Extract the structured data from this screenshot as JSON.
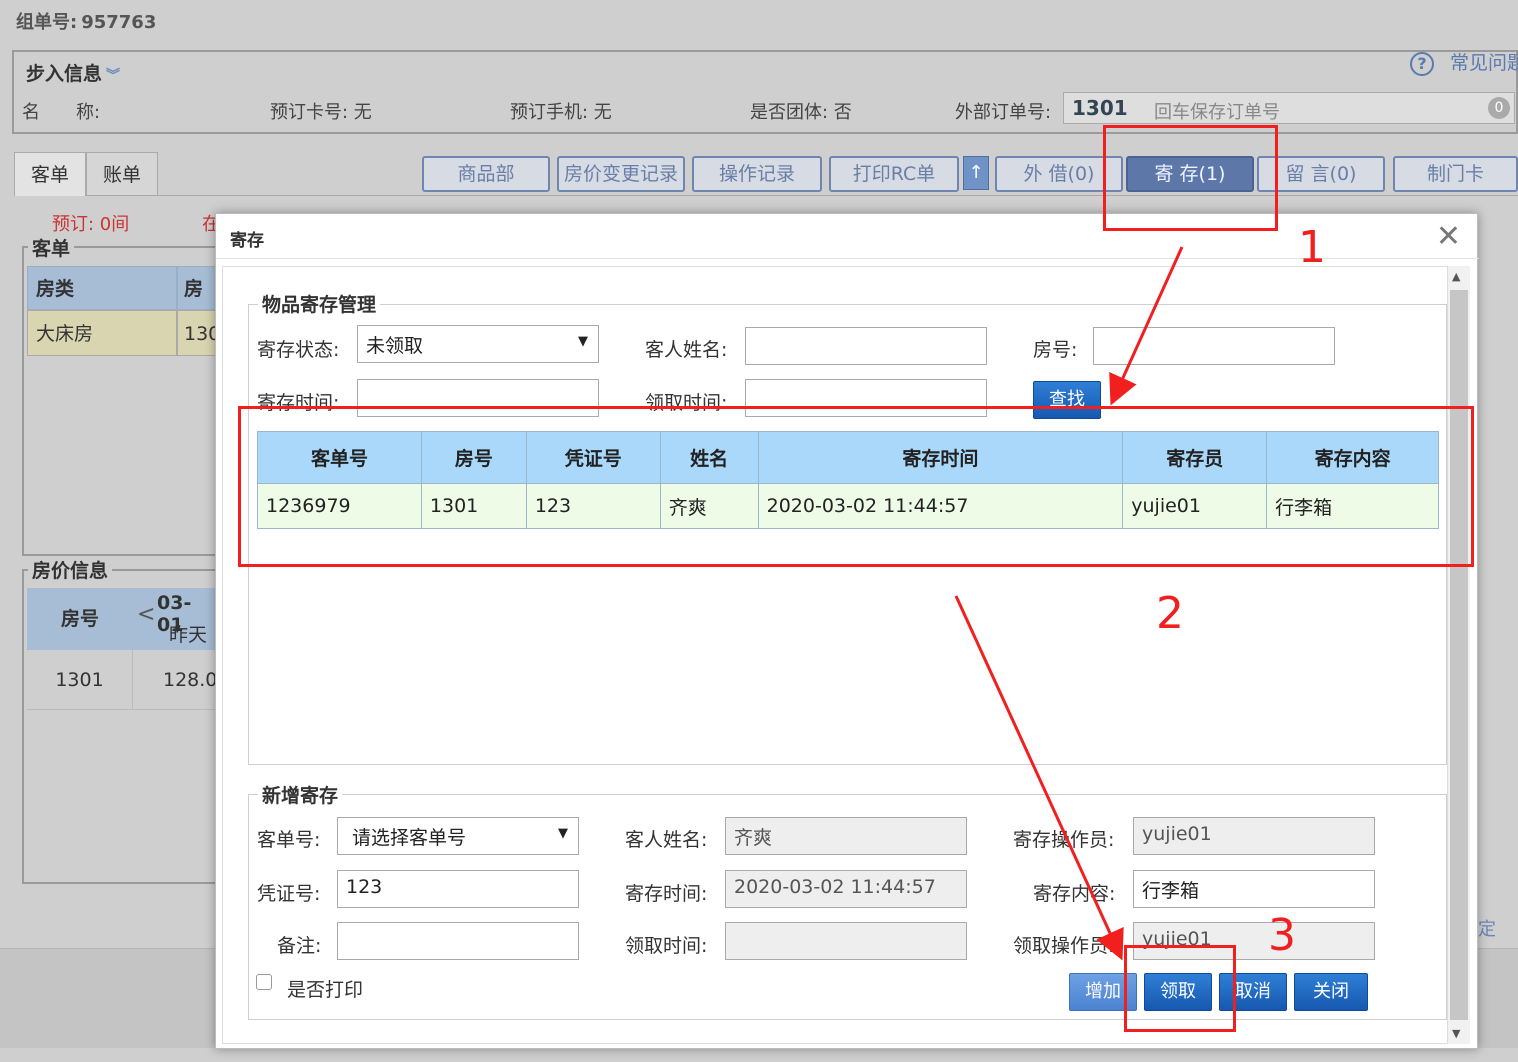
{
  "header": {
    "order_label": "组单号:",
    "order_no": "957763"
  },
  "checkin": {
    "legend": "步入信息",
    "name_label": "名　　称:",
    "card_label": "预订卡号: 无",
    "phone_label": "预订手机: 无",
    "group_label": "是否团体: 否",
    "ext_label": "外部订单号:",
    "ext_value": "1301",
    "ext_placeholder": "回车保存订单号",
    "ext_badge": "0",
    "faq": "常见问题"
  },
  "tabs": [
    "客单",
    "账单"
  ],
  "toolbar": {
    "buttons": [
      "商品部",
      "房价变更记录",
      "操作记录",
      "打印RC单",
      "外 借(0)",
      "寄 存(1)",
      "留 言(0)",
      "制门卡"
    ],
    "up_icon": "↑"
  },
  "bg": {
    "reserve_text": "预订: 0间",
    "in_text": "在",
    "guest_legend": "客单",
    "guest_cols": [
      "房类",
      "房号"
    ],
    "guest_row": [
      "大床房",
      "130"
    ],
    "price_legend": "房价信息",
    "price_col_room": "房号",
    "price_date": "03-01",
    "price_day": "昨天",
    "price_prev": "<",
    "price_row": [
      "1301",
      "128.0"
    ],
    "side_text": "定"
  },
  "modal": {
    "title": "寄存",
    "close": "✕",
    "search": {
      "legend": "物品寄存管理",
      "status_label": "寄存状态:",
      "status_value": "未领取",
      "guest_label": "客人姓名:",
      "room_label": "房号:",
      "store_time_label": "寄存时间:",
      "pickup_time_label": "领取时间:",
      "find_button": "查找"
    },
    "table": {
      "columns": [
        "客单号",
        "房号",
        "凭证号",
        "姓名",
        "寄存时间",
        "寄存员",
        "寄存内容"
      ],
      "rows": [
        [
          "1236979",
          "1301",
          "123",
          "齐爽",
          "2020-03-02 11:44:57",
          "yujie01",
          "行李箱"
        ]
      ]
    },
    "add": {
      "legend": "新增寄存",
      "order_label": "客单号:",
      "order_value": "请选择客单号",
      "guest_label": "客人姓名:",
      "guest_value": "齐爽",
      "operator_label": "寄存操作员:",
      "operator_value": "yujie01",
      "voucher_label": "凭证号:",
      "voucher_value": "123",
      "store_time_label": "寄存时间:",
      "store_time_value": "2020-03-02 11:44:57",
      "content_label": "寄存内容:",
      "content_value": "行李箱",
      "remark_label": "备注:",
      "remark_value": "",
      "pickup_time_label": "领取时间:",
      "pickup_time_value": "",
      "pickup_operator_label": "领取操作员:",
      "pickup_operator_value": "yujie01",
      "print_label": "是否打印",
      "buttons": [
        "增加",
        "领取",
        "取消",
        "关闭"
      ]
    }
  },
  "annotations": [
    "1",
    "2",
    "3"
  ],
  "colors": {
    "annotation": "#f21f1f",
    "header_blue": "#a9d8fa",
    "row_green": "#eefbe6",
    "button_blue": "#1758b0"
  }
}
